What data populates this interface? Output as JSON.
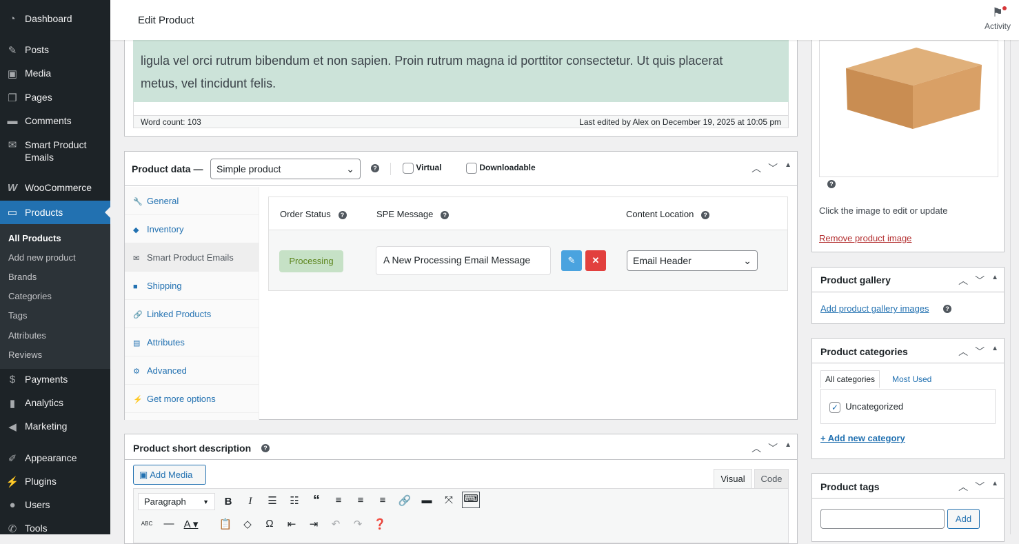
{
  "sidebar": {
    "items": [
      {
        "label": "Dashboard",
        "icon": "dashboard-icon"
      },
      {
        "label": "Posts",
        "icon": "pin-icon"
      },
      {
        "label": "Media",
        "icon": "media-icon"
      },
      {
        "label": "Pages",
        "icon": "pages-icon"
      },
      {
        "label": "Comments",
        "icon": "comment-icon"
      },
      {
        "label": "Smart Product",
        "label2": "Emails",
        "icon": "envelope-icon"
      },
      {
        "label": "WooCommerce",
        "icon": "woo-icon"
      },
      {
        "label": "Products",
        "icon": "archive-icon"
      },
      {
        "label": "Payments",
        "icon": "dollar-icon"
      },
      {
        "label": "Analytics",
        "icon": "bar-chart-icon"
      },
      {
        "label": "Marketing",
        "icon": "megaphone-icon"
      },
      {
        "label": "Appearance",
        "icon": "brush-icon"
      },
      {
        "label": "Plugins",
        "icon": "plug-icon"
      },
      {
        "label": "Users",
        "icon": "user-icon"
      },
      {
        "label": "Tools",
        "icon": "wrench-icon"
      }
    ],
    "submenu": [
      "All Products",
      "Add new product",
      "Brands",
      "Categories",
      "Tags",
      "Attributes",
      "Reviews"
    ]
  },
  "header": {
    "title": "Edit Product",
    "activity": "Activity"
  },
  "editor": {
    "text1": "ligula vel orci rutrum bibendum et non sapien. Proin rutrum magna id porttitor consectetur. Ut quis placerat",
    "text2": "metus, vel tincidunt felis.",
    "word_count": "Word count: 103",
    "last_edited": "Last edited by Alex on December 19, 2025 at 10:05 pm"
  },
  "product_data": {
    "title": "Product data —",
    "type": "Simple product",
    "virtual": "Virtual",
    "downloadable": "Downloadable",
    "tabs": [
      {
        "label": "General",
        "icon": "wrench-icon"
      },
      {
        "label": "Inventory",
        "icon": "tag-icon"
      },
      {
        "label": "Smart Product Emails",
        "icon": "envelope-icon"
      },
      {
        "label": "Shipping",
        "icon": "truck-icon"
      },
      {
        "label": "Linked Products",
        "icon": "link-icon"
      },
      {
        "label": "Attributes",
        "icon": "list-icon"
      },
      {
        "label": "Advanced",
        "icon": "gear-icon"
      },
      {
        "label": "Get more options",
        "icon": "plug-icon"
      }
    ],
    "columns": [
      "Order Status",
      "SPE Message",
      "Content Location"
    ],
    "row": {
      "status": "Processing",
      "message": "A New Processing Email Message",
      "location": "Email Header"
    }
  },
  "short_desc": {
    "title": "Product short description",
    "add_media": "Add Media",
    "visual": "Visual",
    "code": "Code",
    "format": "Paragraph"
  },
  "image_box": {
    "hint": "Click the image to edit or update",
    "remove": "Remove product image"
  },
  "gallery": {
    "title": "Product gallery",
    "add": "Add product gallery images"
  },
  "categories": {
    "title": "Product categories",
    "tab_all": "All categories",
    "tab_most": "Most Used",
    "item": "Uncategorized",
    "add": "+ Add new category"
  },
  "tags": {
    "title": "Product tags",
    "add": "Add"
  },
  "colors": {
    "accent": "#2271b1",
    "sidebar": "#1d2327",
    "status_bg": "#c6e1c6"
  }
}
